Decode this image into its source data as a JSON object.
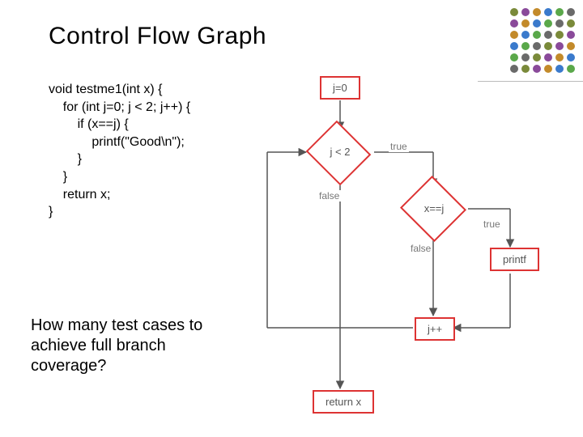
{
  "title": "Control Flow Graph",
  "code_lines": [
    "void testme1(int x) {",
    "    for (int j=0; j < 2; j++) {",
    "        if (x==j) {",
    "            printf(\"Good\\n\");",
    "        }",
    "    }",
    "    return x;",
    "}"
  ],
  "question": "How many test cases to achieve full branch coverage?",
  "flow": {
    "nodes": {
      "init": {
        "label": "j=0",
        "shape": "rect"
      },
      "cond1": {
        "label": "j < 2",
        "shape": "diamond"
      },
      "cond2": {
        "label": "x==j",
        "shape": "diamond"
      },
      "printf": {
        "label": "printf",
        "shape": "rect"
      },
      "inc": {
        "label": "j++",
        "shape": "rect"
      },
      "ret": {
        "label": "return x",
        "shape": "rect"
      }
    },
    "edges": [
      {
        "from": "init",
        "to": "cond1",
        "label": ""
      },
      {
        "from": "cond1",
        "to": "cond2",
        "label": "true"
      },
      {
        "from": "cond1",
        "to": "ret",
        "label": "false"
      },
      {
        "from": "cond2",
        "to": "printf",
        "label": "true"
      },
      {
        "from": "cond2",
        "to": "inc",
        "label": "false"
      },
      {
        "from": "printf",
        "to": "inc",
        "label": ""
      },
      {
        "from": "inc",
        "to": "cond1",
        "label": ""
      }
    ],
    "edge_labels": {
      "true": "true",
      "false": "false"
    }
  },
  "dots_palette": [
    "#7a8a3a",
    "#8a4a9a",
    "#c38a2a",
    "#3a7acc",
    "#5aa84a",
    "#6a6a6a"
  ]
}
